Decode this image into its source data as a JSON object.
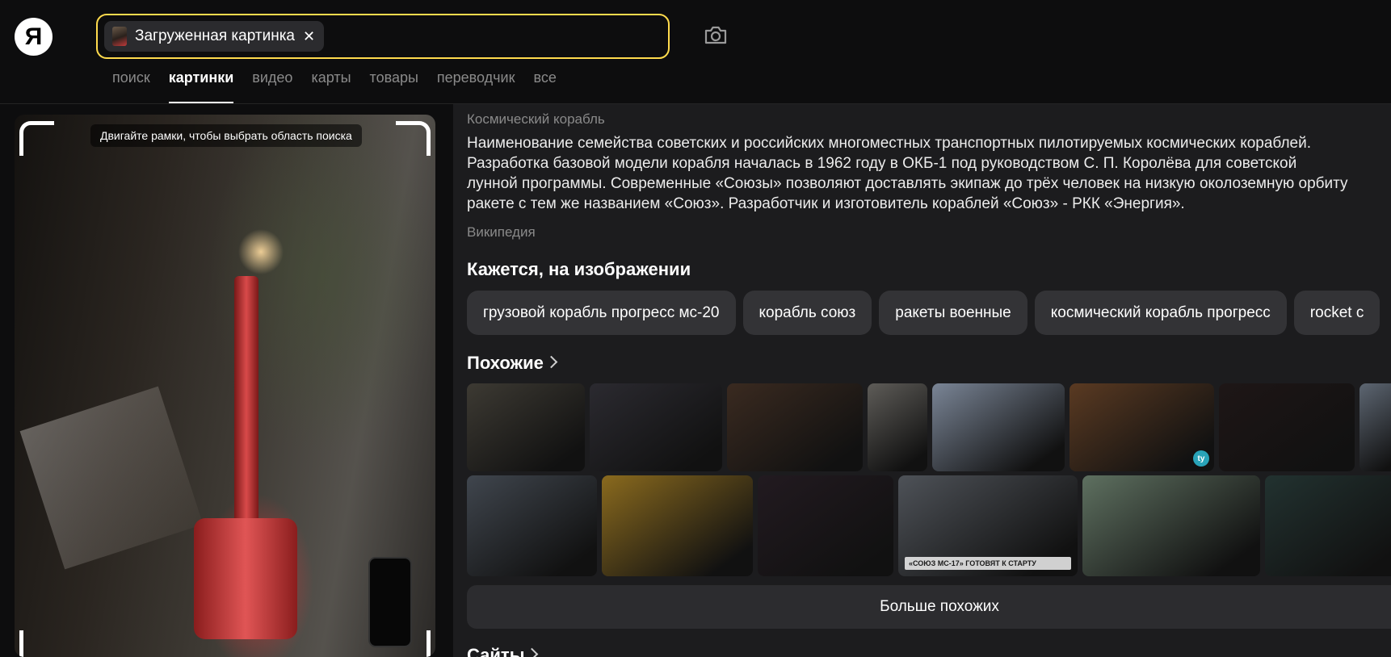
{
  "header": {
    "logo": "Я",
    "search_chip_label": "Загруженная картинка",
    "chip_close": "✕"
  },
  "tabs": [
    {
      "label": "поиск",
      "active": false
    },
    {
      "label": "картинки",
      "active": true
    },
    {
      "label": "видео",
      "active": false
    },
    {
      "label": "карты",
      "active": false
    },
    {
      "label": "товары",
      "active": false
    },
    {
      "label": "переводчик",
      "active": false
    },
    {
      "label": "все",
      "active": false
    }
  ],
  "viewer": {
    "hint": "Двигайте рамки, чтобы выбрать область поиска"
  },
  "entity": {
    "title": "Космический корабль",
    "description_lines": [
      "Наименование семейства советских и российских многоместных транспортных пилотируемых космических кораблей.",
      "Разработка базовой модели корабля началась в 1962 году в ОКБ-1 под руководством С. П. Королёва для советской",
      "лунной программы. Современные «Союзы» позволяют доставлять экипаж до трёх человек на низкую околоземную орбиту",
      "ракете с тем же названием «Союз». Разработчик и изготовитель кораблей «Союз» - РКК «Энергия»."
    ],
    "source": "Википедия"
  },
  "detected": {
    "title": "Кажется, на изображении",
    "tags": [
      "грузовой корабль прогресс мс-20",
      "корабль союз",
      "ракеты военные",
      "космический корабль прогресс",
      "rocket c"
    ]
  },
  "similar": {
    "title": "Похожие",
    "more_label": "Больше похожих",
    "badge_text": "ty",
    "caption_text": "«СОЮЗ МС-17» ГОТОВЯТ К СТАРТУ",
    "colors": [
      "#3d3a33",
      "#2b2a30",
      "#3a2a20",
      "#5e5c58",
      "#7a8596",
      "#5a3a22",
      "#1e1616",
      "#5d6672",
      "#40464e",
      "#8a6a1e",
      "#221a20",
      "#4e5258",
      "#5e7060",
      "#223230"
    ]
  },
  "sites": {
    "title": "Сайты"
  }
}
